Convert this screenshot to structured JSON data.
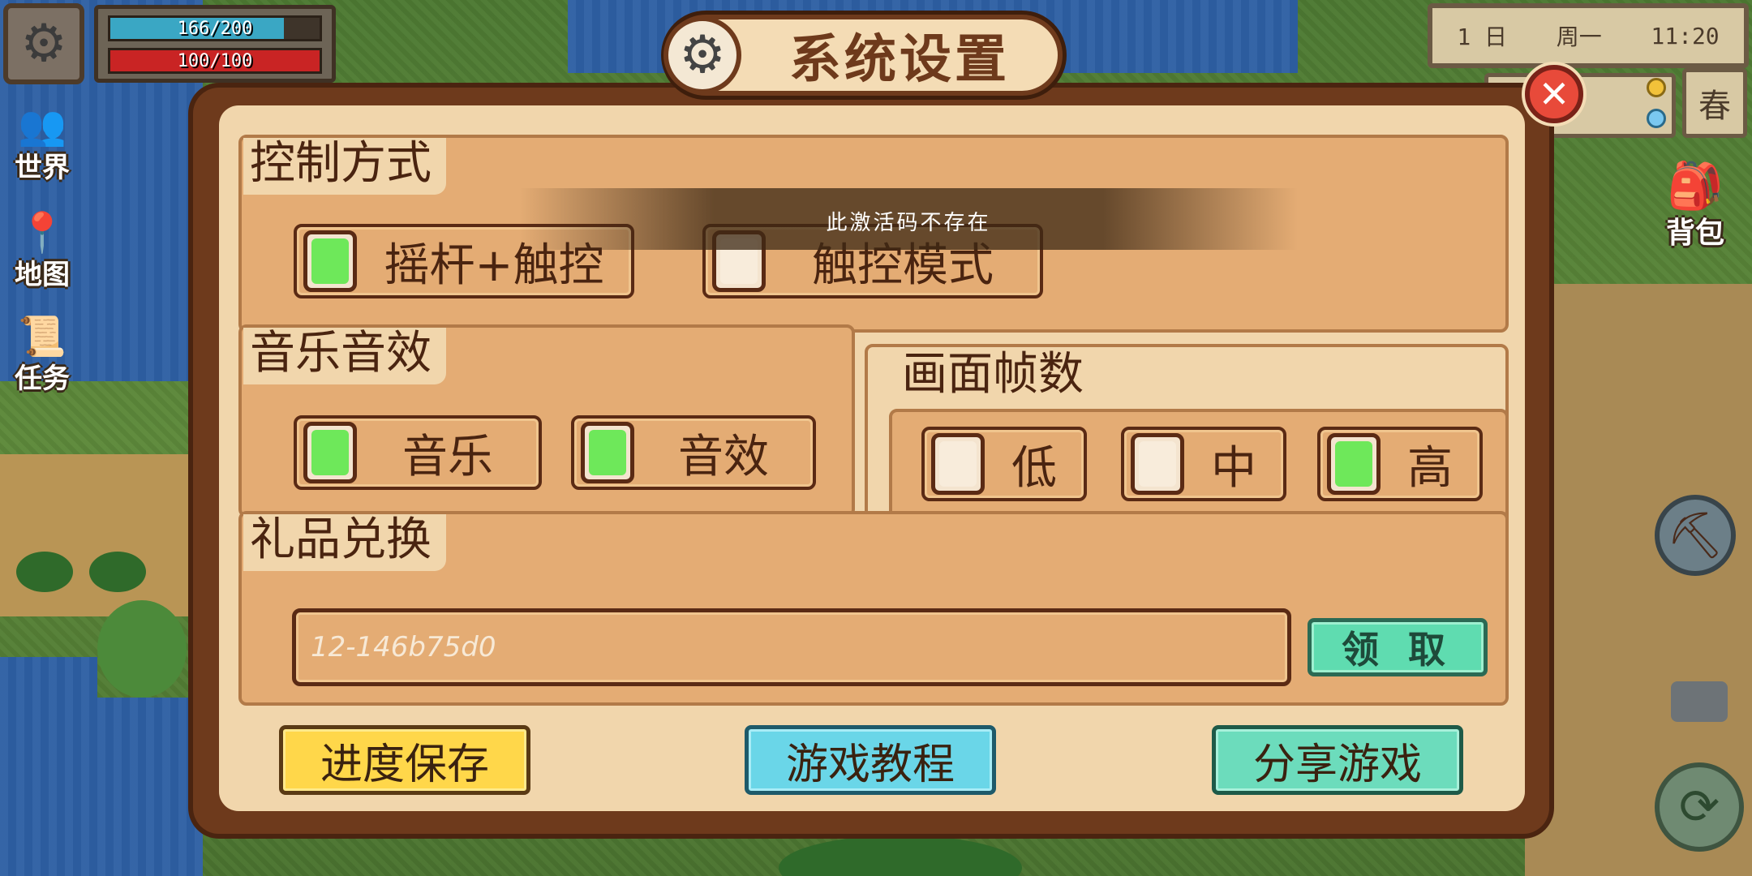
{
  "hud": {
    "hp_text": "166/200",
    "hp_fraction": 0.83,
    "energy_text": "100/100",
    "energy_fraction": 1.0,
    "settings_icon": "gear-icon",
    "side_menu": [
      {
        "label": "世界",
        "icon": "friends-icon"
      },
      {
        "label": "地图",
        "icon": "map-pin-icon"
      },
      {
        "label": "任务",
        "icon": "quest-scroll-icon"
      }
    ],
    "date": {
      "day": "1 日",
      "weekday": "周一",
      "time": "11:20"
    },
    "season": "春",
    "bag_label": "背包"
  },
  "dialog": {
    "title": "系统设置",
    "sections": {
      "control": {
        "title": "控制方式",
        "options": [
          {
            "label": "摇杆+触控",
            "checked": true
          },
          {
            "label": "触控模式",
            "checked": false
          }
        ]
      },
      "audio": {
        "title": "音乐音效",
        "options": [
          {
            "label": "音乐",
            "checked": true
          },
          {
            "label": "音效",
            "checked": true
          }
        ]
      },
      "fps": {
        "title": "画面帧数",
        "options": [
          {
            "label": "低",
            "checked": false
          },
          {
            "label": "中",
            "checked": false
          },
          {
            "label": "高",
            "checked": true
          }
        ]
      },
      "gift": {
        "title": "礼品兑换",
        "code_value": "12-146b75d0",
        "claim_label": "领 取"
      }
    },
    "buttons": {
      "save": "进度保存",
      "tutorial": "游戏教程",
      "share": "分享游戏"
    },
    "toast": "此激活码不存在"
  },
  "colors": {
    "checked": "#6ee85a",
    "frame": "#6e3a1c",
    "panel": "#e4ac74",
    "save_btn": "#ffd74a",
    "tutorial_btn": "#6ad6e8",
    "share_btn": "#6cdcbc",
    "close_btn": "#e84a3a"
  }
}
